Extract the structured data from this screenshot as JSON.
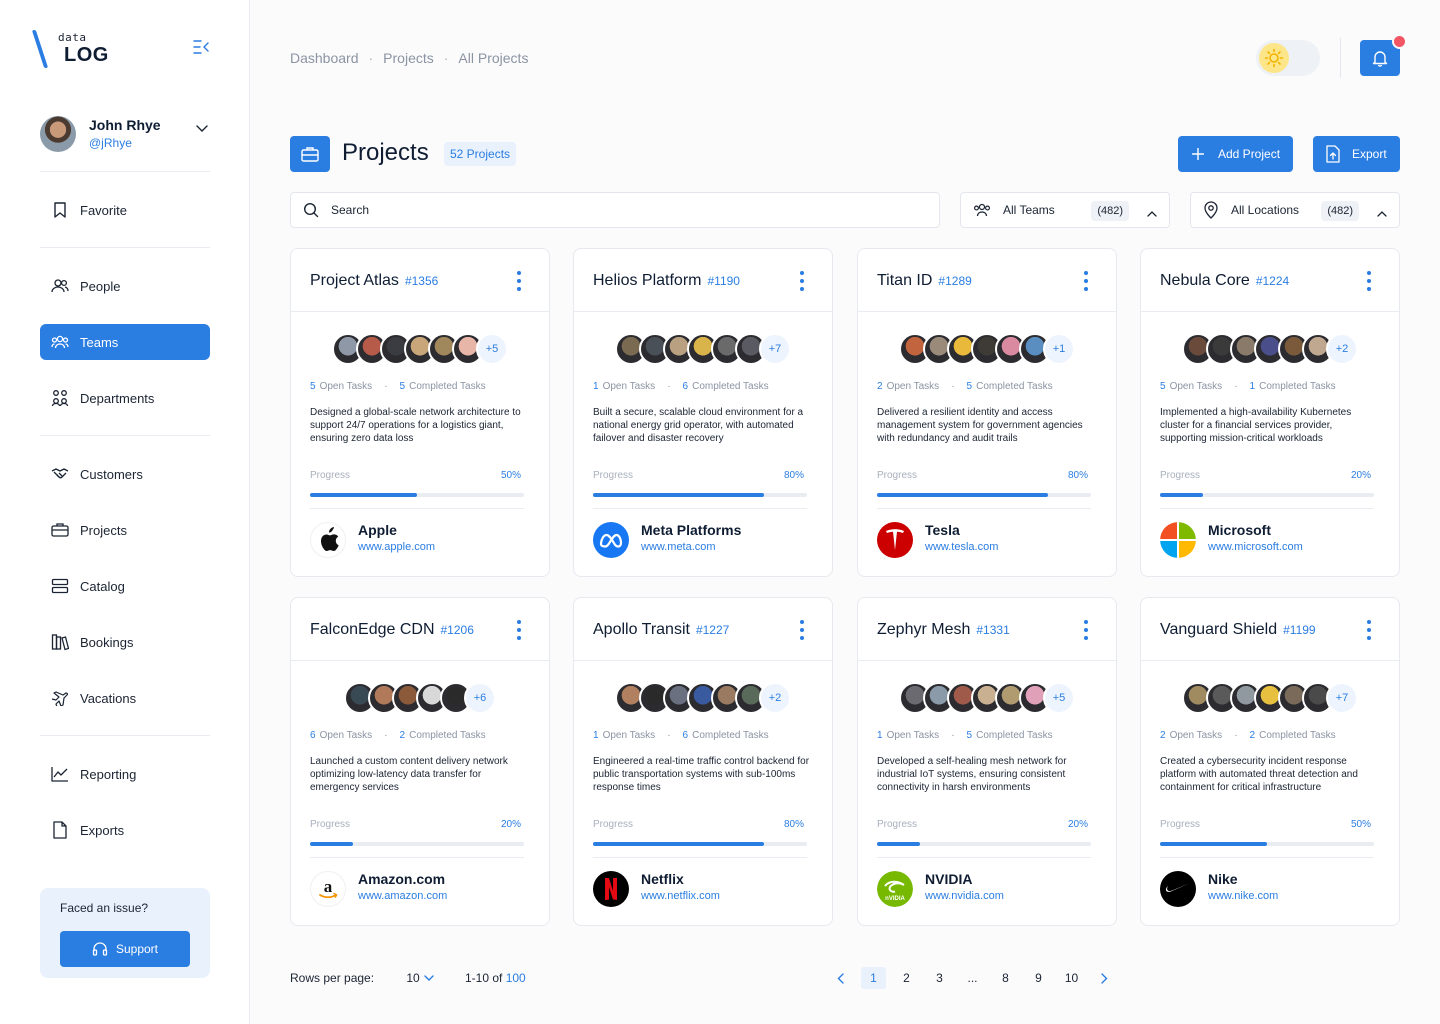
{
  "app": {
    "logo_small": "data",
    "logo_big": "LOG"
  },
  "user": {
    "name": "John Rhye",
    "handle": "@jRhye"
  },
  "sidebar": {
    "items": [
      {
        "label": "Favorite",
        "icon": "bookmark-icon"
      },
      {
        "label": "People",
        "icon": "people-icon"
      },
      {
        "label": "Teams",
        "icon": "teams-icon",
        "active": true
      },
      {
        "label": "Departments",
        "icon": "departments-icon"
      },
      {
        "label": "Customers",
        "icon": "handshake-icon"
      },
      {
        "label": "Projects",
        "icon": "briefcase-icon"
      },
      {
        "label": "Catalog",
        "icon": "catalog-icon"
      },
      {
        "label": "Bookings",
        "icon": "books-icon"
      },
      {
        "label": "Vacations",
        "icon": "plane-icon"
      },
      {
        "label": "Reporting",
        "icon": "chart-line-icon"
      },
      {
        "label": "Exports",
        "icon": "file-icon"
      }
    ],
    "help": {
      "question": "Faced an issue?",
      "button": "Support"
    }
  },
  "breadcrumb": [
    "Dashboard",
    "Projects",
    "All Projects"
  ],
  "page": {
    "title": "Projects",
    "count": "52 Projects",
    "add_label": "Add Project",
    "export_label": "Export"
  },
  "filters": {
    "search_placeholder": "Search",
    "teams": {
      "label": "All Teams",
      "count": "(482)"
    },
    "locations": {
      "label": "All Locations",
      "count": "(482)"
    }
  },
  "labels": {
    "open_tasks": "Open Tasks",
    "completed_tasks": "Completed Tasks",
    "progress": "Progress"
  },
  "colors": {
    "accent": "#2a7de1",
    "notification": "#f25563"
  },
  "projects": [
    {
      "name": "Project Atlas",
      "id": "#1356",
      "more": "+5",
      "open": "5",
      "completed": "5",
      "description": "Designed a global-scale network architecture to support 24/7 operations for a logistics giant, ensuring zero data loss",
      "progress": "50%",
      "client": "Apple",
      "url": "www.apple.com"
    },
    {
      "name": "Helios Platform",
      "id": "#1190",
      "more": "+7",
      "open": "1",
      "completed": "6",
      "description": "Built a secure, scalable cloud environment for a national energy grid operator, with automated failover and disaster recovery",
      "progress": "80%",
      "client": "Meta Platforms",
      "url": "www.meta.com"
    },
    {
      "name": "Titan ID",
      "id": "#1289",
      "more": "+1",
      "open": "2",
      "completed": "5",
      "description": "Delivered a resilient identity and access management system for government agencies with redundancy and audit trails",
      "progress": "80%",
      "client": "Tesla",
      "url": "www.tesla.com"
    },
    {
      "name": "Nebula Core",
      "id": "#1224",
      "more": "+2",
      "open": "5",
      "completed": "1",
      "description": "Implemented a high-availability Kubernetes cluster for a financial services provider, supporting mission-critical workloads",
      "progress": "20%",
      "client": "Microsoft",
      "url": "www.microsoft.com"
    },
    {
      "name": "FalconEdge CDN",
      "id": "#1206",
      "more": "+6",
      "open": "6",
      "completed": "2",
      "description": "Launched a custom content delivery network optimizing low-latency data transfer for emergency services",
      "progress": "20%",
      "client": "Amazon.com",
      "url": "www.amazon.com"
    },
    {
      "name": "Apollo Transit",
      "id": "#1227",
      "more": "+2",
      "open": "1",
      "completed": "6",
      "description": "Engineered a real-time traffic control backend for public transportation systems with sub-100ms response times",
      "progress": "80%",
      "client": "Netflix",
      "url": "www.netflix.com"
    },
    {
      "name": "Zephyr Mesh",
      "id": "#1331",
      "more": "+5",
      "open": "1",
      "completed": "5",
      "description": "Developed a self-healing mesh network for industrial IoT systems, ensuring consistent connectivity in harsh environments",
      "progress": "20%",
      "client": "NVIDIA",
      "url": "www.nvidia.com"
    },
    {
      "name": "Vanguard Shield",
      "id": "#1199",
      "more": "+7",
      "open": "2",
      "completed": "2",
      "description": "Created a cybersecurity incident response platform with automated threat detection and containment for critical infrastructure",
      "progress": "50%",
      "client": "Nike",
      "url": "www.nike.com"
    }
  ],
  "pagination": {
    "rows_label": "Rows per page:",
    "rows_value": "10",
    "range_prefix": "1-10 of",
    "range_total": "100",
    "pages": [
      "1",
      "2",
      "3",
      "...",
      "8",
      "9",
      "10"
    ],
    "current": "1"
  }
}
